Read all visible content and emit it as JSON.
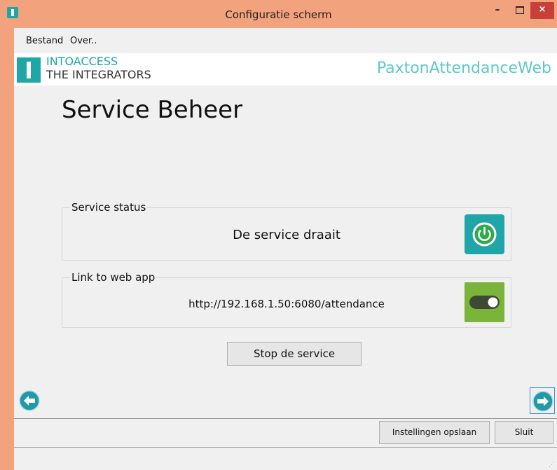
{
  "window": {
    "title": "Configuratie scherm",
    "minimize_label": "–",
    "close_label": "×"
  },
  "menu": {
    "items": [
      {
        "label": "Bestand"
      },
      {
        "label": "Over.."
      }
    ]
  },
  "header": {
    "company_line1": "INTOACCESS",
    "company_line2": "THE INTEGRATORS",
    "product_name": "PaxtonAttendanceWeb"
  },
  "page": {
    "title": "Service Beheer"
  },
  "service_status": {
    "legend": "Service status",
    "text": "De service draait",
    "icon": "power-icon"
  },
  "web_link": {
    "legend": "Link to web app",
    "url": "http://192.168.1.50:6080/attendance",
    "icon": "toggle-icon"
  },
  "actions": {
    "stop_service": "Stop de service"
  },
  "footer": {
    "save_settings": "Instellingen opslaan",
    "close": "Sluit"
  },
  "colors": {
    "titlebar": "#f2a27c",
    "brand_teal": "#1fa6a6",
    "product_text": "#5fc8c8",
    "toggle_green": "#7ab43a",
    "close_red": "#c7403a"
  }
}
